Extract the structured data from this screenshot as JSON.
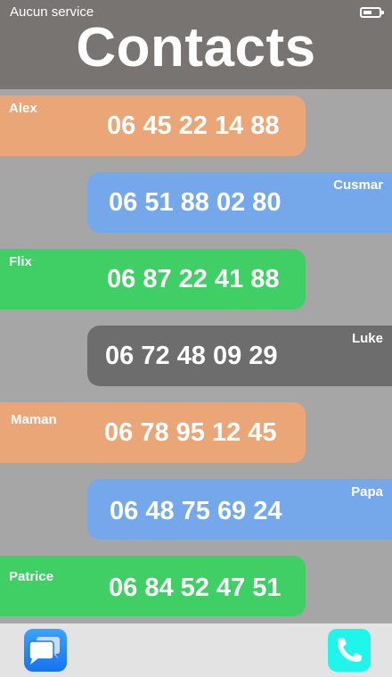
{
  "status_bar": {
    "carrier": "Aucun service",
    "battery_icon": "battery-icon"
  },
  "header": {
    "title": "Contacts"
  },
  "contacts": [
    {
      "name": "Alex",
      "phone": "06 45 22 14 88",
      "color": "#eba678"
    },
    {
      "name": "Cusmar",
      "phone": "06 51 88 02 80",
      "color": "#75a8ea"
    },
    {
      "name": "Flix",
      "phone": "06 87 22 41 88",
      "color": "#3fcf65"
    },
    {
      "name": "Luke",
      "phone": "06 72 48 09 29",
      "color": "#6d6d6d"
    },
    {
      "name": "Maman",
      "phone": "06 78 95 12 45",
      "color": "#eba678"
    },
    {
      "name": "Papa",
      "phone": "06 48 75 69 24",
      "color": "#75a8ea"
    },
    {
      "name": "Patrice",
      "phone": "06 84 52 47 51",
      "color": "#3fcf65"
    }
  ],
  "bottom_bar": {
    "messages_icon": "messages-icon",
    "phone_icon": "phone-icon"
  }
}
